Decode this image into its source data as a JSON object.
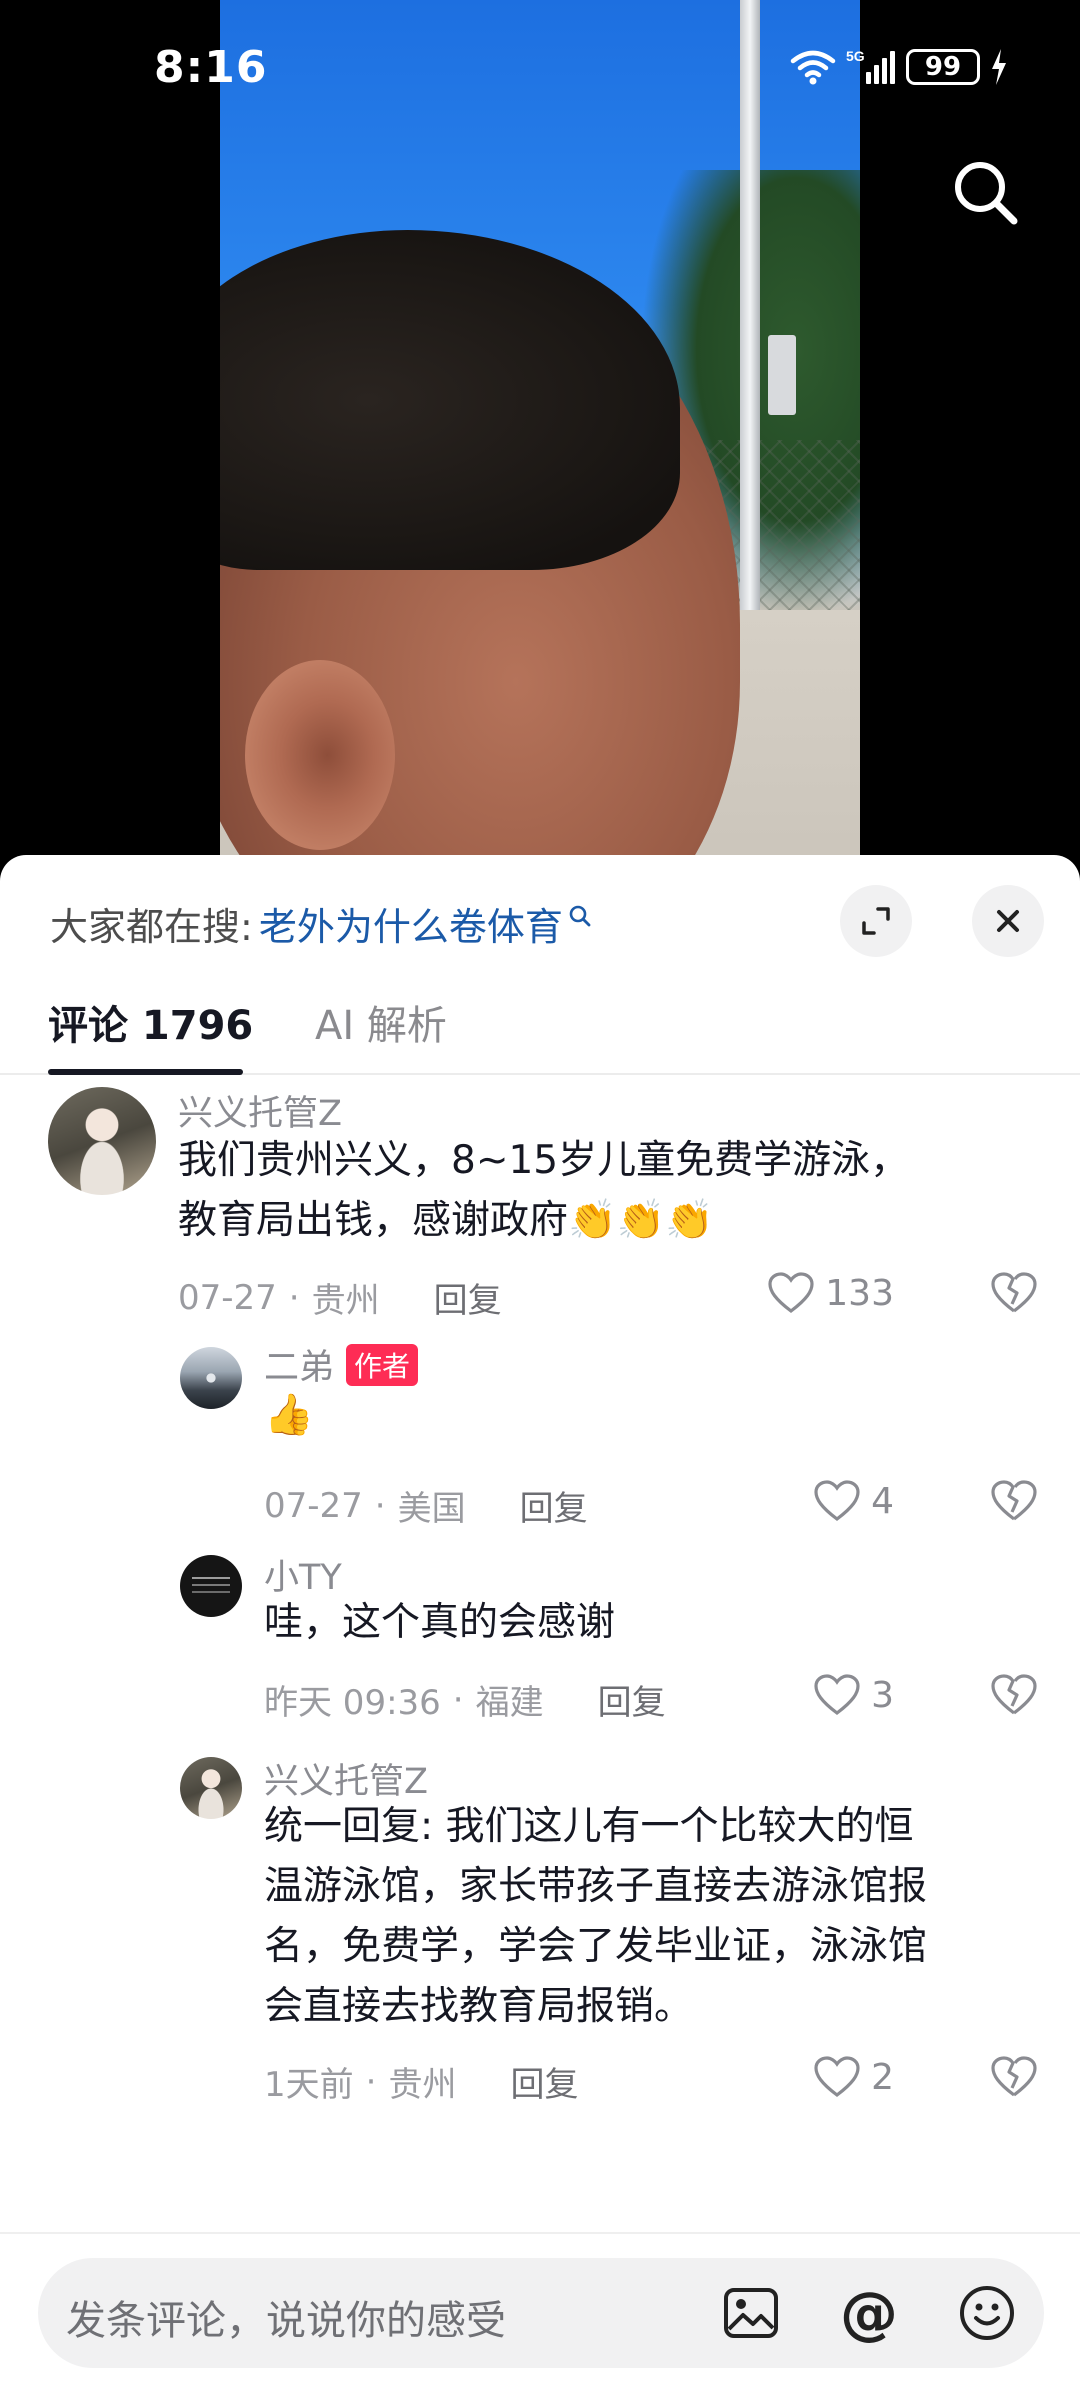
{
  "status_bar": {
    "time": "8:16",
    "network": "5G",
    "battery": "99"
  },
  "sheet": {
    "hot_search_label": "大家都在搜:",
    "hot_search_term": "老外为什么卷体育",
    "tabs": [
      {
        "label": "评论 1796",
        "active": true
      },
      {
        "label": "AI 解析",
        "active": false
      }
    ]
  },
  "comments": [
    {
      "user": "兴义托管Z",
      "lines": [
        "我们贵州兴义，8~15岁儿童免费学游泳，",
        "教育局出钱，感谢政府👏👏👏"
      ],
      "date": "07-27",
      "location": "贵州",
      "reply": "回复",
      "likes": "133"
    },
    {
      "user": "二弟",
      "badge": "作者",
      "lines": [
        "👍"
      ],
      "date": "07-27",
      "location": "美国",
      "reply": "回复",
      "likes": "4"
    },
    {
      "user": "小TY",
      "lines": [
        "哇，这个真的会感谢"
      ],
      "date": "昨天 09:36",
      "location": "福建",
      "reply": "回复",
      "likes": "3"
    },
    {
      "user": "兴义托管Z",
      "lines": [
        "统一回复: 我们这儿有一个比较大的恒",
        "温游泳馆，家长带孩子直接去游泳馆报",
        "名，免费学，学会了发毕业证，泳泳馆",
        "会直接去找教育局报销。"
      ],
      "date": "1天前",
      "location": "贵州",
      "reply": "回复",
      "likes": "2"
    }
  ],
  "input": {
    "placeholder": "发条评论，说说你的感受",
    "at_symbol": "@"
  },
  "colors": {
    "accent_link": "#1b5aa8",
    "author_badge": "#fe2c55",
    "text_primary": "#161823",
    "text_secondary": "#8a8b91"
  },
  "icons": [
    "wifi-icon",
    "signal-icon",
    "charging-icon",
    "search-icon",
    "expand-icon",
    "close-icon",
    "heart-icon",
    "dislike-icon",
    "image-icon",
    "at-icon",
    "emoji-icon"
  ]
}
